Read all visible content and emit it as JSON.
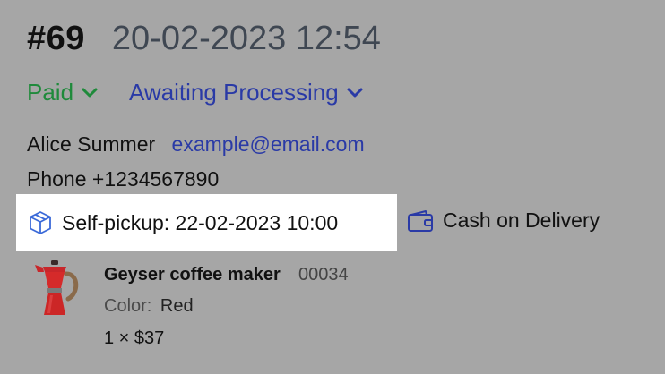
{
  "order": {
    "id": "#69",
    "datetime": "20-02-2023 12:54"
  },
  "status": {
    "payment": "Paid",
    "fulfillment": "Awaiting Processing",
    "payment_color": "#1f8a3b",
    "fulfillment_color": "#2a3aa6",
    "dropdown_icon": "chevron-down-icon"
  },
  "customer": {
    "name": "Alice Summer",
    "email": "example@email.com",
    "phone": "Phone +1234567890"
  },
  "delivery": {
    "label": "Self-pickup: 22-02-2023 10:00",
    "icon": "box-icon"
  },
  "payment_method": {
    "label": "Cash on Delivery",
    "icon": "wallet-icon"
  },
  "items": [
    {
      "name": "Geyser coffee maker",
      "sku": "00034",
      "variant_key": "Color:",
      "variant_value": "Red",
      "qty_price": "1 × $37",
      "image_icon": "coffee-maker-image"
    }
  ]
}
